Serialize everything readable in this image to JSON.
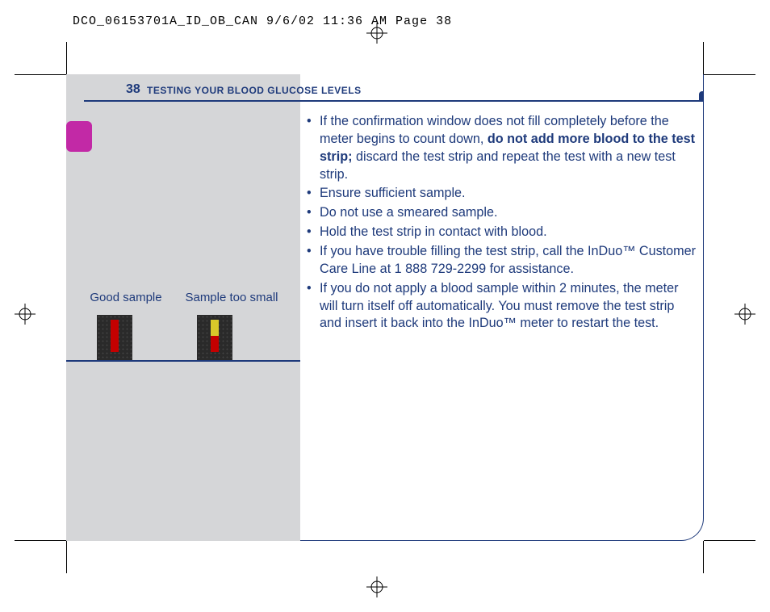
{
  "print_slug": "DCO_06153701A_ID_OB_CAN  9/6/02  11:36 AM  Page 38",
  "page_number": "38",
  "section_title": "TESTING YOUR BLOOD GLUCOSE LEVELS",
  "sample_labels": {
    "good": "Good sample",
    "too_small": "Sample too small"
  },
  "bullets": {
    "b1_pre": "If the confirmation window does not fill completely before the meter begins to count down, ",
    "b1_bold": "do not add more blood to the test strip;",
    "b1_post": " discard the test strip and repeat the test with a new test strip.",
    "b2": "Ensure sufficient sample.",
    "b3": "Do not use a smeared sample.",
    "b4": "Hold the test strip in contact with blood.",
    "b5": "If you have trouble filling the test strip, call the InDuo™ Customer Care Line at 1 888 729-2299 for assistance.",
    "b6": "If you do not apply a blood sample within 2 minutes, the meter will turn itself off automatically. You must remove the test strip and insert it back into the InDuo™ meter to restart the test."
  }
}
